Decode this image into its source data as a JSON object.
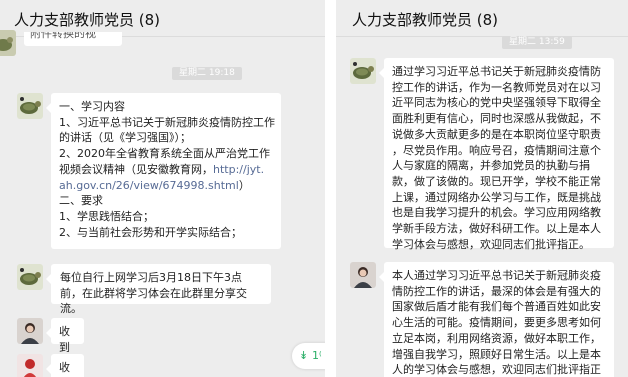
{
  "left": {
    "title": "人力支部教师党员 (8)",
    "partial_message": "附件转换的视",
    "timestamp": "星期二 19:18",
    "notice": {
      "lines": [
        "一、学习内容",
        "1、习近平总书记关于新冠肺炎疫情防控工作",
        "的讲话（见《学习强国》）；",
        "2、2020年全省教育系统全面从严治党工作",
        "视频会议精神（见安徽教育网，"
      ],
      "link_line_1": "http://jyt.",
      "link_line_2": "ah.gov.cn/26/view/674998.shtml",
      "link_suffix": "）",
      "lines_after": [
        "二、要求",
        "1、学思践悟结合；",
        "2、与当前社会形势和开学实际结合；"
      ]
    },
    "message_2": "每位自行上网学习后3月18日下午3点前，在此群将学习体会在此群里分享交流。",
    "message_3": "收到",
    "message_4": "收到",
    "unread_label": "1⁽",
    "unread_icon": "double-chevron-down-icon",
    "accent_color": "#2aae67"
  },
  "right": {
    "title": "人力支部教师党员 (8)",
    "timestamp": "星期二 13:59",
    "message_1": [
      "通过学习习近平总书记关于新冠肺炎疫情防",
      "控工作的讲话，作为一名教师党员对在以习",
      "近平同志为核心的党中央坚强领导下取得全",
      "面胜利更有信心，同时也深感从我做起，不",
      "说做多大贡献更多的是在本职岗位坚守职责",
      "，尽党员作用。响应号召，疫情期间注意个",
      "人与家庭的隔离，并参加党员的执勤与捐",
      "款，做了该做的。现已开学，学校不能正常",
      "上课，通过网络办公学习与工作，既是挑战",
      "也是自我学习提升的机会。学习应用网络教",
      "学新手段方法，做好科研工作。以上是本人",
      "学习体会与感想，欢迎同志们批评指正。"
    ],
    "message_2": [
      "本人通过学习习近平总书记关于新冠肺炎疫",
      "情防控工作的讲话，最深的体会是有强大的",
      "国家做后盾才能有我们每个普通百姓如此安",
      "心生活的可能。疫情期间，要更多思考如何",
      "立足本岗，利用网络资源，做好本职工作，",
      "增强自我学习，照顾好日常生活。以上是本",
      "人的学习体会与感想，欢迎同志们批评指正"
    ]
  }
}
